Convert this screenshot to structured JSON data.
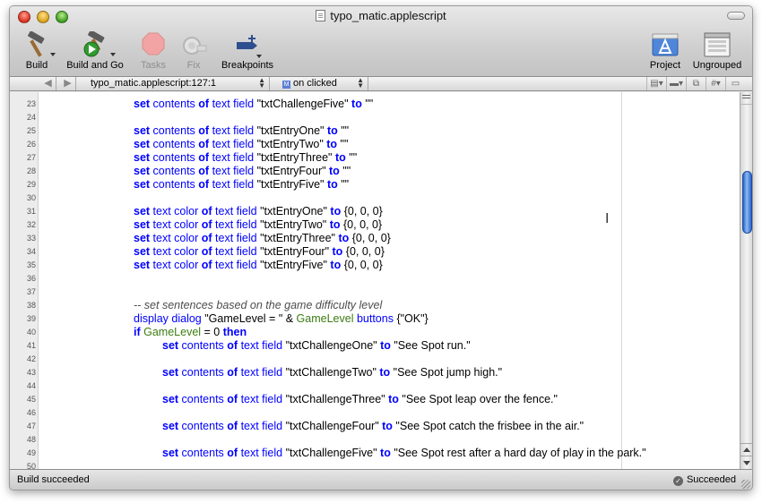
{
  "window": {
    "title": "typo_matic.applescript"
  },
  "toolbar": {
    "build": "Build",
    "build_and_go": "Build and Go",
    "tasks": "Tasks",
    "fix": "Fix",
    "breakpoints": "Breakpoints",
    "project": "Project",
    "ungrouped": "Ungrouped"
  },
  "navbar": {
    "back": "◀",
    "forward": "▶",
    "file_location": "typo_matic.applescript:127:1",
    "function": "on clicked",
    "function_badge": "M"
  },
  "editor": {
    "colors": {
      "keyword": "#0000ff",
      "variable": "#3c7d12",
      "comment": "#4d4d4d"
    },
    "lines": [
      {
        "num": "23",
        "indent": 1,
        "tokens": [
          [
            "kw",
            "set"
          ],
          [
            "cmd",
            " contents "
          ],
          [
            "kw",
            "of"
          ],
          [
            "cmd",
            " text field "
          ],
          [
            "str",
            "\"txtChallengeFive\" "
          ],
          [
            "kw",
            "to"
          ],
          [
            "str",
            " \"\""
          ]
        ]
      },
      {
        "num": "24",
        "indent": 0,
        "tokens": []
      },
      {
        "num": "25",
        "indent": 1,
        "tokens": [
          [
            "kw",
            "set"
          ],
          [
            "cmd",
            " contents "
          ],
          [
            "kw",
            "of"
          ],
          [
            "cmd",
            " text field "
          ],
          [
            "str",
            "\"txtEntryOne\" "
          ],
          [
            "kw",
            "to"
          ],
          [
            "str",
            " \"\""
          ]
        ]
      },
      {
        "num": "26",
        "indent": 1,
        "tokens": [
          [
            "kw",
            "set"
          ],
          [
            "cmd",
            " contents "
          ],
          [
            "kw",
            "of"
          ],
          [
            "cmd",
            " text field "
          ],
          [
            "str",
            "\"txtEntryTwo\" "
          ],
          [
            "kw",
            "to"
          ],
          [
            "str",
            " \"\""
          ]
        ]
      },
      {
        "num": "27",
        "indent": 1,
        "tokens": [
          [
            "kw",
            "set"
          ],
          [
            "cmd",
            " contents "
          ],
          [
            "kw",
            "of"
          ],
          [
            "cmd",
            " text field "
          ],
          [
            "str",
            "\"txtEntryThree\" "
          ],
          [
            "kw",
            "to"
          ],
          [
            "str",
            " \"\""
          ]
        ]
      },
      {
        "num": "28",
        "indent": 1,
        "tokens": [
          [
            "kw",
            "set"
          ],
          [
            "cmd",
            " contents "
          ],
          [
            "kw",
            "of"
          ],
          [
            "cmd",
            " text field "
          ],
          [
            "str",
            "\"txtEntryFour\" "
          ],
          [
            "kw",
            "to"
          ],
          [
            "str",
            " \"\""
          ]
        ]
      },
      {
        "num": "29",
        "indent": 1,
        "tokens": [
          [
            "kw",
            "set"
          ],
          [
            "cmd",
            " contents "
          ],
          [
            "kw",
            "of"
          ],
          [
            "cmd",
            " text field "
          ],
          [
            "str",
            "\"txtEntryFive\" "
          ],
          [
            "kw",
            "to"
          ],
          [
            "str",
            " \"\""
          ]
        ]
      },
      {
        "num": "30",
        "indent": 0,
        "tokens": []
      },
      {
        "num": "31",
        "indent": 1,
        "tokens": [
          [
            "kw",
            "set"
          ],
          [
            "cmd",
            " text color "
          ],
          [
            "kw",
            "of"
          ],
          [
            "cmd",
            " text field "
          ],
          [
            "str",
            "\"txtEntryOne\" "
          ],
          [
            "kw",
            "to"
          ],
          [
            "str",
            " {0, 0, 0}"
          ]
        ]
      },
      {
        "num": "32",
        "indent": 1,
        "tokens": [
          [
            "kw",
            "set"
          ],
          [
            "cmd",
            " text color "
          ],
          [
            "kw",
            "of"
          ],
          [
            "cmd",
            " text field "
          ],
          [
            "str",
            "\"txtEntryTwo\" "
          ],
          [
            "kw",
            "to"
          ],
          [
            "str",
            " {0, 0, 0}"
          ]
        ]
      },
      {
        "num": "33",
        "indent": 1,
        "tokens": [
          [
            "kw",
            "set"
          ],
          [
            "cmd",
            " text color "
          ],
          [
            "kw",
            "of"
          ],
          [
            "cmd",
            " text field "
          ],
          [
            "str",
            "\"txtEntryThree\" "
          ],
          [
            "kw",
            "to"
          ],
          [
            "str",
            " {0, 0, 0}"
          ]
        ]
      },
      {
        "num": "34",
        "indent": 1,
        "tokens": [
          [
            "kw",
            "set"
          ],
          [
            "cmd",
            " text color "
          ],
          [
            "kw",
            "of"
          ],
          [
            "cmd",
            " text field "
          ],
          [
            "str",
            "\"txtEntryFour\" "
          ],
          [
            "kw",
            "to"
          ],
          [
            "str",
            " {0, 0, 0}"
          ]
        ]
      },
      {
        "num": "35",
        "indent": 1,
        "tokens": [
          [
            "kw",
            "set"
          ],
          [
            "cmd",
            " text color "
          ],
          [
            "kw",
            "of"
          ],
          [
            "cmd",
            " text field "
          ],
          [
            "str",
            "\"txtEntryFive\" "
          ],
          [
            "kw",
            "to"
          ],
          [
            "str",
            " {0, 0, 0}"
          ]
        ]
      },
      {
        "num": "36",
        "indent": 0,
        "tokens": []
      },
      {
        "num": "37",
        "indent": 0,
        "tokens": []
      },
      {
        "num": "38",
        "indent": 1,
        "tokens": [
          [
            "cmt",
            "-- set sentences based on the game difficulty level"
          ]
        ]
      },
      {
        "num": "39",
        "indent": 1,
        "tokens": [
          [
            "cmd",
            "display dialog "
          ],
          [
            "str",
            "\"GameLevel = \" & "
          ],
          [
            "var",
            "GameLevel"
          ],
          [
            "cmd",
            " buttons "
          ],
          [
            "str",
            "{\"OK\"}"
          ]
        ]
      },
      {
        "num": "40",
        "indent": 1,
        "tokens": [
          [
            "kw",
            "if"
          ],
          [
            "str",
            " "
          ],
          [
            "var",
            "GameLevel"
          ],
          [
            "str",
            " = 0 "
          ],
          [
            "kw",
            "then"
          ]
        ]
      },
      {
        "num": "41",
        "indent": 2,
        "tokens": [
          [
            "kw",
            "set"
          ],
          [
            "cmd",
            " contents "
          ],
          [
            "kw",
            "of"
          ],
          [
            "cmd",
            " text field "
          ],
          [
            "str",
            "\"txtChallengeOne\" "
          ],
          [
            "kw",
            "to"
          ],
          [
            "str",
            " \"See Spot run.\""
          ]
        ]
      },
      {
        "num": "42",
        "indent": 0,
        "tokens": []
      },
      {
        "num": "43",
        "indent": 2,
        "tokens": [
          [
            "kw",
            "set"
          ],
          [
            "cmd",
            " contents "
          ],
          [
            "kw",
            "of"
          ],
          [
            "cmd",
            " text field "
          ],
          [
            "str",
            "\"txtChallengeTwo\" "
          ],
          [
            "kw",
            "to"
          ],
          [
            "str",
            " \"See Spot jump high.\""
          ]
        ]
      },
      {
        "num": "44",
        "indent": 0,
        "tokens": []
      },
      {
        "num": "45",
        "indent": 2,
        "tokens": [
          [
            "kw",
            "set"
          ],
          [
            "cmd",
            " contents "
          ],
          [
            "kw",
            "of"
          ],
          [
            "cmd",
            " text field "
          ],
          [
            "str",
            "\"txtChallengeThree\" "
          ],
          [
            "kw",
            "to"
          ],
          [
            "str",
            " \"See Spot leap over the fence.\""
          ]
        ]
      },
      {
        "num": "46",
        "indent": 0,
        "tokens": []
      },
      {
        "num": "47",
        "indent": 2,
        "tokens": [
          [
            "kw",
            "set"
          ],
          [
            "cmd",
            " contents "
          ],
          [
            "kw",
            "of"
          ],
          [
            "cmd",
            " text field "
          ],
          [
            "str",
            "\"txtChallengeFour\" "
          ],
          [
            "kw",
            "to"
          ],
          [
            "str",
            " \"See Spot catch the frisbee in the air.\""
          ]
        ]
      },
      {
        "num": "48",
        "indent": 0,
        "tokens": []
      },
      {
        "num": "49",
        "indent": 2,
        "tokens": [
          [
            "kw",
            "set"
          ],
          [
            "cmd",
            " contents "
          ],
          [
            "kw",
            "of"
          ],
          [
            "cmd",
            " text field "
          ],
          [
            "str",
            "\"txtChallengeFive\" "
          ],
          [
            "kw",
            "to"
          ],
          [
            "str",
            " \"See Spot rest after a hard day of play in the park.\""
          ]
        ]
      },
      {
        "num": "50",
        "indent": 0,
        "tokens": []
      }
    ]
  },
  "status": {
    "left": "Build succeeded",
    "right": "Succeeded"
  }
}
